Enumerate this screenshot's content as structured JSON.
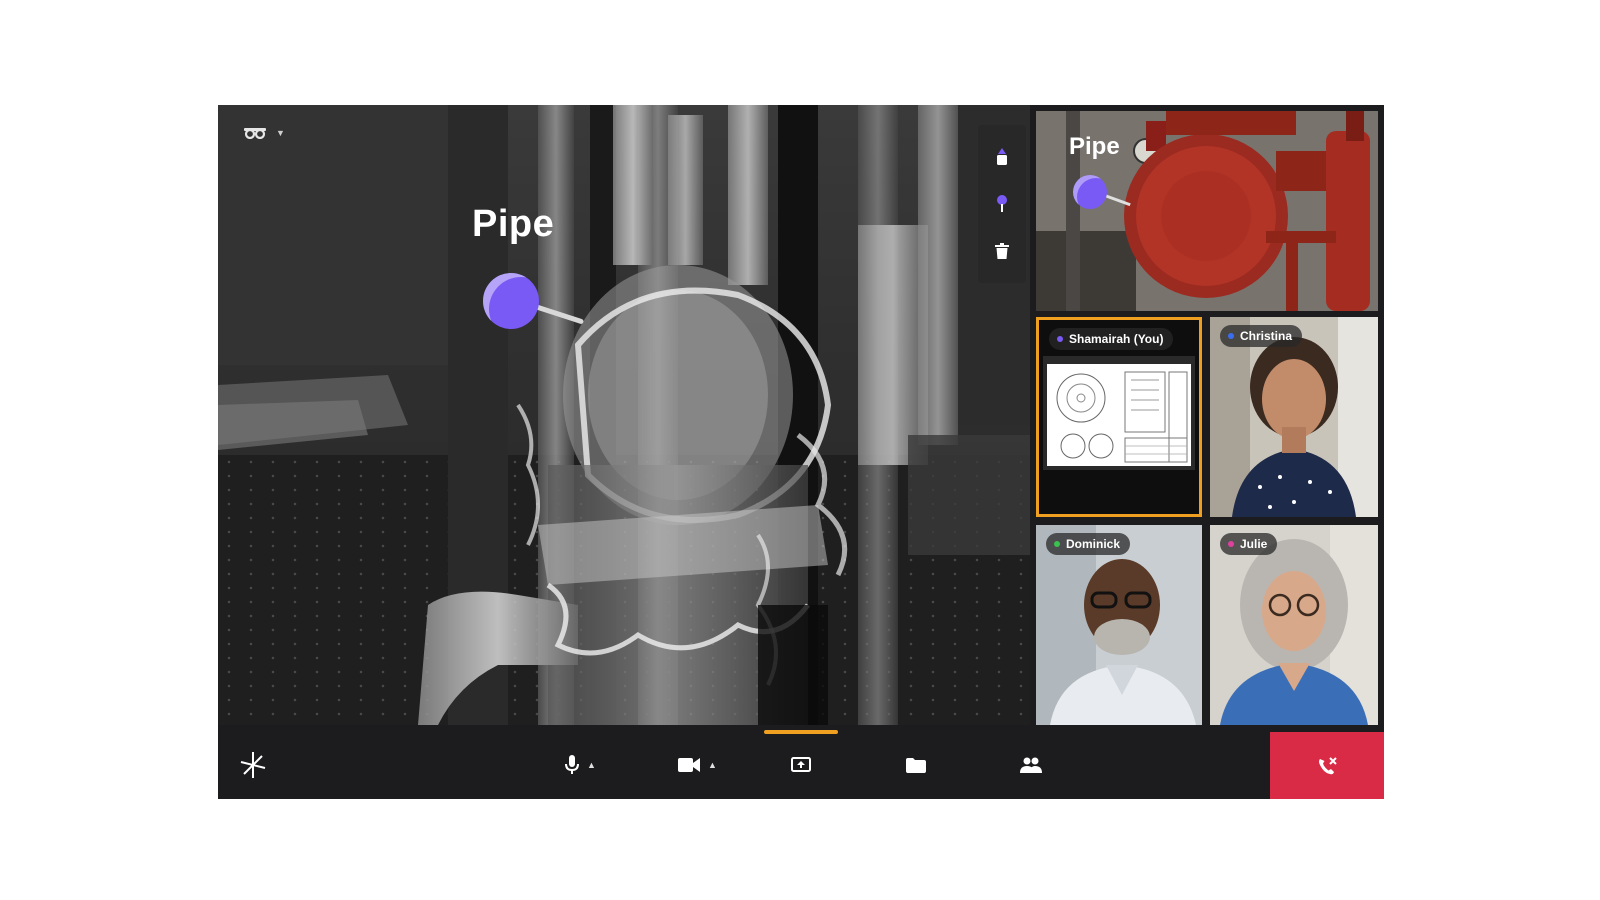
{
  "viewport": {
    "annotation_label": "Pipe",
    "view_mode_icon": "headset-icon",
    "tools": [
      {
        "name": "pointer-tool",
        "icon": "pointer-tool-icon"
      },
      {
        "name": "pin-tool",
        "icon": "pin-icon"
      },
      {
        "name": "delete-tool",
        "icon": "trash-icon"
      }
    ]
  },
  "shared_feed": {
    "annotation_label": "Pipe"
  },
  "participants": [
    {
      "name": "Shamairah (You)",
      "dot_color": "#7a5af5"
    },
    {
      "name": "Christina",
      "dot_color": "#3a6ef0"
    },
    {
      "name": "Dominick",
      "dot_color": "#3cc050"
    },
    {
      "name": "Julie",
      "dot_color": "#e040a0"
    }
  ],
  "controls": {
    "logo_icon": "asterisk-logo-icon",
    "mic_icon": "microphone-icon",
    "camera_icon": "video-camera-icon",
    "share_icon": "screen-share-icon",
    "files_icon": "folder-icon",
    "people_icon": "people-icon",
    "end_call_icon": "end-call-icon"
  },
  "colors": {
    "accent": "#f0a020",
    "pin": "#7a5af5",
    "end_call": "#d92b45"
  }
}
